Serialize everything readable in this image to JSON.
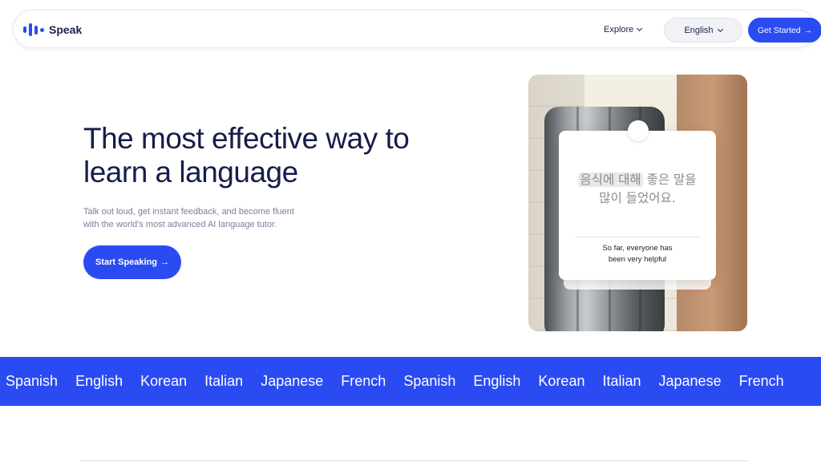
{
  "header": {
    "logo_text": "Speak",
    "explore_label": "Explore",
    "language_label": "English",
    "cta_label": "Get Started",
    "cta_arrow": "→"
  },
  "hero": {
    "title_line1": "The most effective way to",
    "title_line2": "learn a language",
    "subtitle_line1": "Talk out loud, get instant feedback, and become fluent",
    "subtitle_line2": "with the world's most advanced AI language tutor.",
    "cta_label": "Start Speaking",
    "cta_arrow": "→"
  },
  "phrase_card": {
    "highlight": "음식에 대해",
    "rest_line1": "좋은 말을",
    "line2": "많이 들었어요.",
    "translation_line1": "So far, everyone has",
    "translation_line2": "been very helpful"
  },
  "languages": [
    "Spanish",
    "English",
    "Korean",
    "Italian",
    "Japanese",
    "French",
    "Spanish",
    "English",
    "Korean",
    "Italian",
    "Japanese",
    "French"
  ],
  "colors": {
    "brand": "#2a4bf2",
    "heading": "#161d4a",
    "muted": "#7a7f99"
  }
}
